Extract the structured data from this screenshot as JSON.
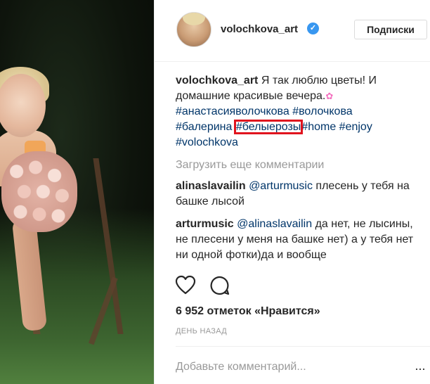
{
  "post": {
    "username": "volochkova_art",
    "follow_button": "Подписки",
    "verified_mark": "✓",
    "caption": {
      "user": "volochkova_art",
      "text": " Я так люблю цветы! И домашние красивые вечера.",
      "emoji": "✿",
      "tags": [
        "#анастасияволочкова",
        "#волочкова",
        "#балерина",
        "#белыерозы",
        "#home",
        "#enjoy",
        "#volochkova"
      ]
    },
    "load_more": "Загрузить еще комментарии",
    "comments": [
      {
        "user": "alinaslavailin",
        "mention": "@arturmusic",
        "text": " плесень у тебя на башке лысой"
      },
      {
        "user": "arturmusic",
        "mention": "@alinaslavailin",
        "text": " да нет, не лысины, не плесени у меня на башке нет) а у тебя нет ни одной фотки)да и вообще"
      }
    ],
    "likes": "6 952 отметок «Нравится»",
    "time": "ДЕНЬ НАЗАД",
    "add_comment_placeholder": "Добавьте комментарий...",
    "more_label": "···",
    "icons": [
      "heart-icon",
      "comment-icon",
      "more-options-icon",
      "verified-icon"
    ],
    "highlight_color": "#e0141e",
    "link_color": "#003569"
  }
}
